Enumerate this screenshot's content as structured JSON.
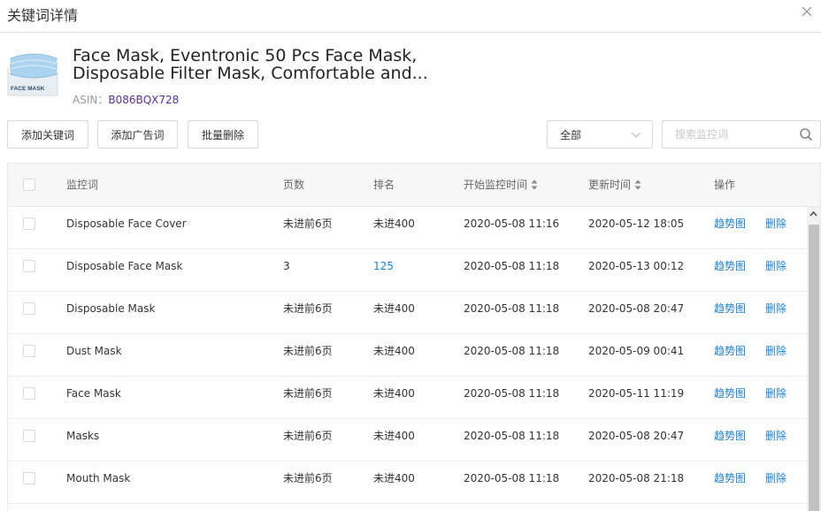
{
  "dialog": {
    "title": "关键词详情"
  },
  "product": {
    "title": "Face Mask, Eventronic 50 Pcs Face Mask, Disposable Filter Mask, Comfortable and...",
    "asin_label": "ASIN：",
    "asin": "B086BQX728",
    "thumbnail_text": "FACE MASK"
  },
  "toolbar": {
    "add_keyword_label": "添加关键词",
    "add_ad_word_label": "添加广告词",
    "batch_delete_label": "批量删除",
    "filter_selected": "全部",
    "search_placeholder": "搜索监控词"
  },
  "table": {
    "headers": {
      "keyword": "监控词",
      "pages": "页数",
      "rank": "排名",
      "start_time": "开始监控时间",
      "update_time": "更新时间",
      "actions": "操作"
    },
    "rows": [
      {
        "keyword": "Disposable Face Cover",
        "pages": "未进前6页",
        "rank": "未进400",
        "start": "2020-05-08 11:16",
        "update": "2020-05-12 18:05",
        "trend": "趋势图",
        "delete": "删除"
      },
      {
        "keyword": "Disposable Face Mask",
        "pages": "3",
        "rank": "125",
        "start": "2020-05-08 11:18",
        "update": "2020-05-13 00:12",
        "trend": "趋势图",
        "delete": "删除"
      },
      {
        "keyword": "Disposable Mask",
        "pages": "未进前6页",
        "rank": "未进400",
        "start": "2020-05-08 11:18",
        "update": "2020-05-08 20:47",
        "trend": "趋势图",
        "delete": "删除"
      },
      {
        "keyword": "Dust Mask",
        "pages": "未进前6页",
        "rank": "未进400",
        "start": "2020-05-08 11:18",
        "update": "2020-05-09 00:41",
        "trend": "趋势图",
        "delete": "删除"
      },
      {
        "keyword": "Face Mask",
        "pages": "未进前6页",
        "rank": "未进400",
        "start": "2020-05-08 11:18",
        "update": "2020-05-11 11:19",
        "trend": "趋势图",
        "delete": "删除"
      },
      {
        "keyword": "Masks",
        "pages": "未进前6页",
        "rank": "未进400",
        "start": "2020-05-08 11:18",
        "update": "2020-05-08 20:47",
        "trend": "趋势图",
        "delete": "删除"
      },
      {
        "keyword": "Mouth Mask",
        "pages": "未进前6页",
        "rank": "未进400",
        "start": "2020-05-08 11:18",
        "update": "2020-05-08 21:18",
        "trend": "趋势图",
        "delete": "删除"
      }
    ]
  },
  "colors": {
    "link": "#1a7fd4",
    "asin": "#5a2fa0",
    "header_bg": "#f7f7f7",
    "border": "#e8e8e8"
  }
}
